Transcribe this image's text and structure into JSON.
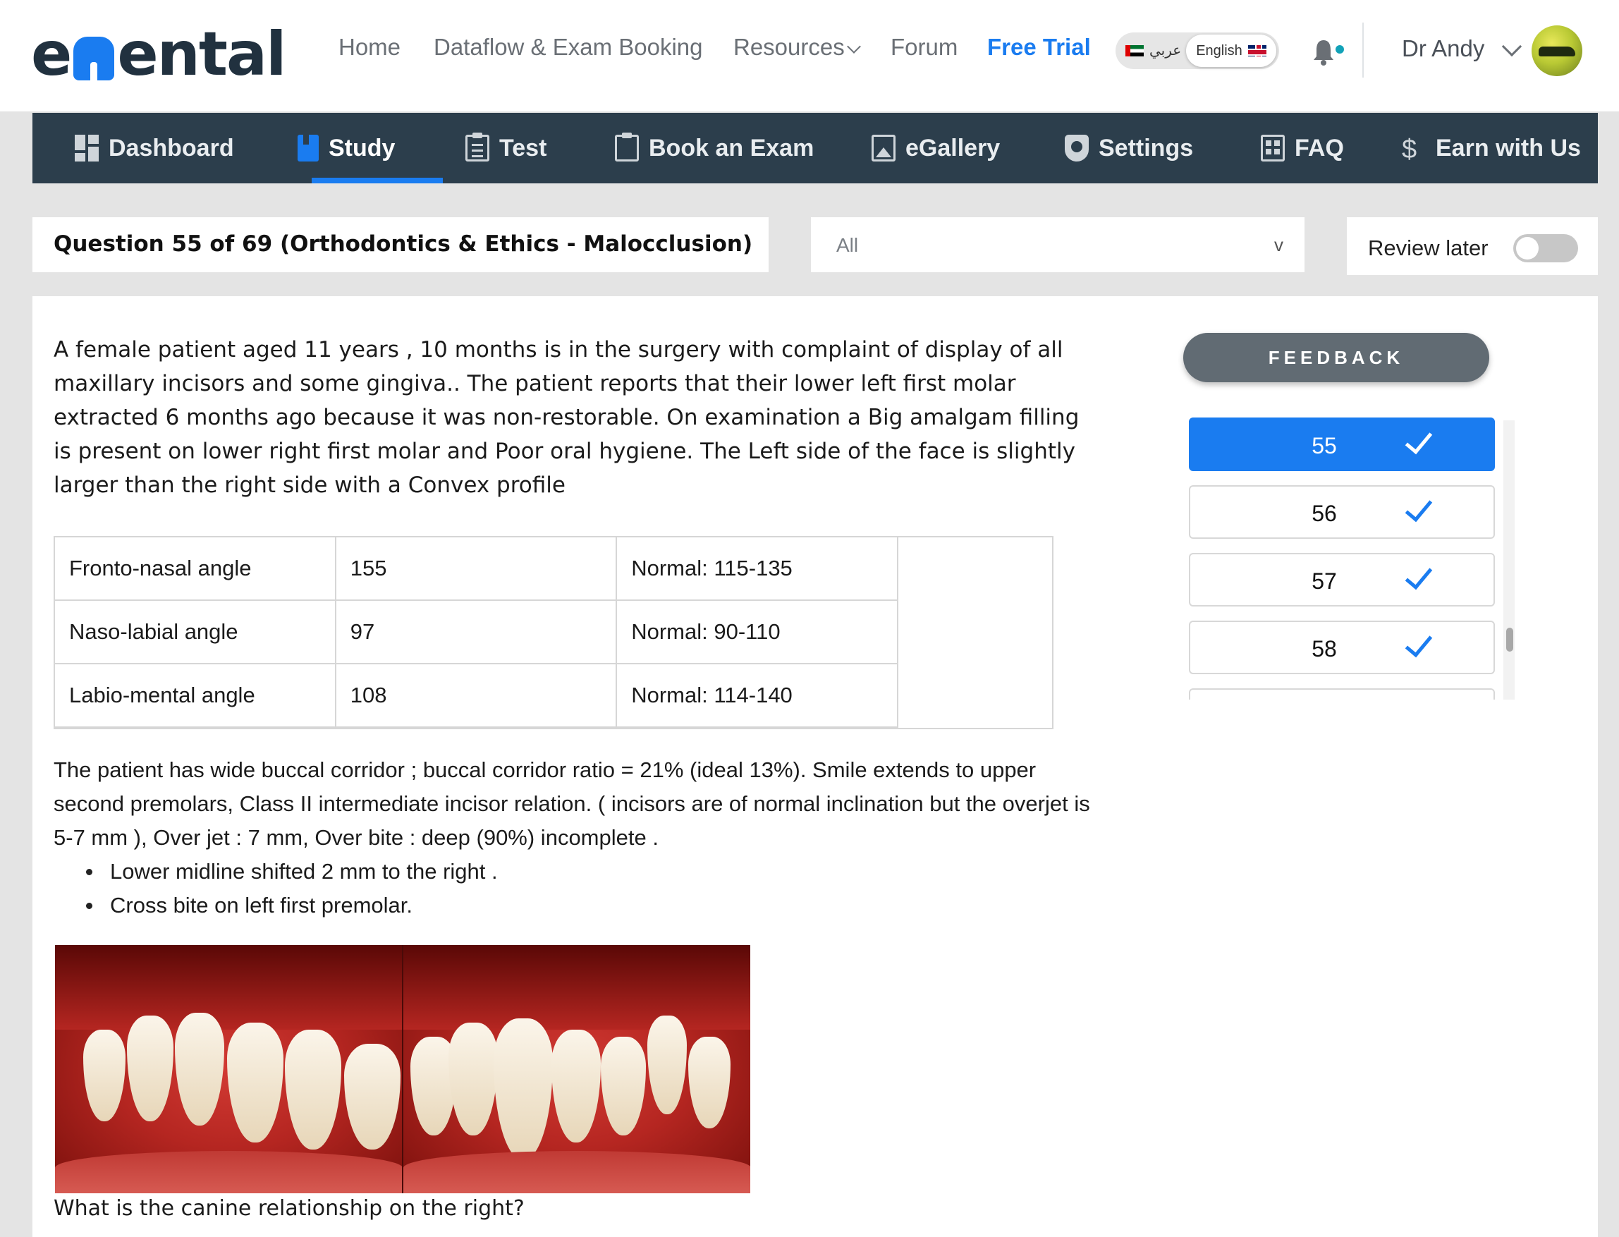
{
  "header": {
    "logo": {
      "prefix": "e",
      "suffix": "ental"
    },
    "nav": [
      {
        "label": "Home"
      },
      {
        "label": "Dataflow & Exam Booking"
      },
      {
        "label": "Resources"
      },
      {
        "label": "Forum"
      },
      {
        "label": "Free Trial"
      }
    ],
    "language": {
      "arabic": "عربي",
      "english": "English",
      "active": "English"
    },
    "notification_icon": "bell-icon",
    "user": {
      "name": "Dr Andy"
    }
  },
  "main_nav": {
    "tabs": [
      {
        "label": "Dashboard",
        "icon": "dashboard-icon"
      },
      {
        "label": "Study",
        "icon": "book-icon",
        "active": true
      },
      {
        "label": "Test",
        "icon": "clipboard-icon"
      },
      {
        "label": "Book an Exam",
        "icon": "clipboard-icon"
      },
      {
        "label": "eGallery",
        "icon": "image-icon"
      },
      {
        "label": "Settings",
        "icon": "shield-icon"
      },
      {
        "label": "FAQ",
        "icon": "list-icon"
      },
      {
        "label": "Earn with Us",
        "icon": "dollar-icon"
      }
    ],
    "accent_color": "#1a7cf0",
    "background_color": "#2c3e4c"
  },
  "question_header": {
    "title": "Question 55 of 69 (Orthodontics & Ethics - Malocclusion)",
    "filter": {
      "value": "All",
      "chevron": "v"
    },
    "review_later": {
      "label": "Review later",
      "checked": false
    }
  },
  "question": {
    "intro": "A female patient aged 11 years , 10 months is in the surgery with complaint of display of all maxillary incisors and some gingiva.. The patient reports that their lower left first molar extracted 6 months ago because it was non-restorable. On examination a Big amalgam filling is present on lower right first molar and Poor oral hygiene. The Left side of the face is slightly larger than the right side with a Convex profile",
    "angles": [
      {
        "name": "Fronto-nasal angle",
        "value": "155",
        "normal": "Normal: 115-135"
      },
      {
        "name": "Naso-labial angle",
        "value": "97",
        "normal": "Normal: 90-110"
      },
      {
        "name": "Labio-mental angle",
        "value": "108",
        "normal": "Normal: 114-140"
      }
    ],
    "findings": "The patient has wide buccal corridor ; buccal corridor ratio = 21% (ideal 13%). Smile extends to upper second premolars, Class II intermediate incisor relation. ( incisors are of normal inclination but the overjet is 5-7 mm ), Over jet : 7 mm, Over bite : deep (90%) incomplete .",
    "bullets": [
      "Lower midline shifted 2 mm to the right .",
      "Cross bite on left first premolar."
    ],
    "prompt": "What is the canine relationship on the right?"
  },
  "sidebar": {
    "feedback_label": "FEEDBACK",
    "questions": [
      {
        "number": "55",
        "answered": true,
        "active": true
      },
      {
        "number": "56",
        "answered": true,
        "active": false
      },
      {
        "number": "57",
        "answered": true,
        "active": false
      },
      {
        "number": "58",
        "answered": true,
        "active": false
      }
    ]
  }
}
